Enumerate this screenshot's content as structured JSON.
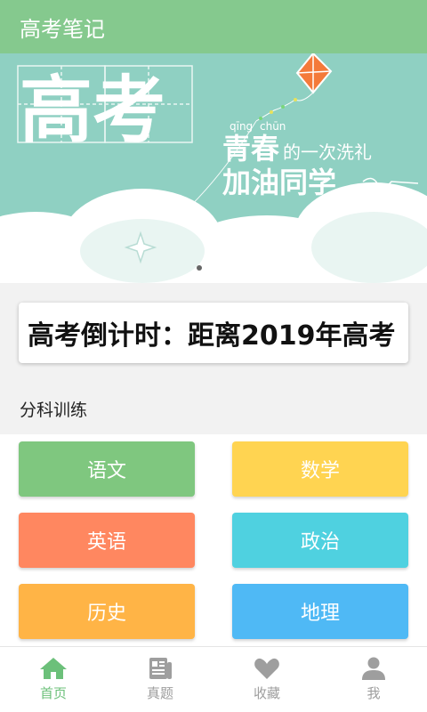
{
  "header": {
    "title": "高考笔记"
  },
  "banner": {
    "title": "高考",
    "pinyin_1": "qīng",
    "pinyin_2": "chūn",
    "line1_big": "青春",
    "line1_small": "的一次洗礼",
    "line2": "加油同学"
  },
  "countdown": {
    "text": "高考倒计时：距离2019年高考"
  },
  "section": {
    "title": "分科训练"
  },
  "subjects": [
    {
      "label": "语文",
      "color": "#7fc77f"
    },
    {
      "label": "数学",
      "color": "#ffd451"
    },
    {
      "label": "英语",
      "color": "#ff8760"
    },
    {
      "label": "政治",
      "color": "#4fd1e0"
    },
    {
      "label": "历史",
      "color": "#ffb446"
    },
    {
      "label": "地理",
      "color": "#4fb9f5"
    }
  ],
  "nav": [
    {
      "label": "首页",
      "icon": "home-icon",
      "active": true
    },
    {
      "label": "真题",
      "icon": "newspaper-icon",
      "active": false
    },
    {
      "label": "收藏",
      "icon": "heart-icon",
      "active": false
    },
    {
      "label": "我",
      "icon": "user-icon",
      "active": false
    }
  ],
  "colors": {
    "header": "#85c98e",
    "banner_bg": "#8fd0c2",
    "nav_active": "#6cc07a",
    "nav_inactive": "#9e9e9e"
  }
}
